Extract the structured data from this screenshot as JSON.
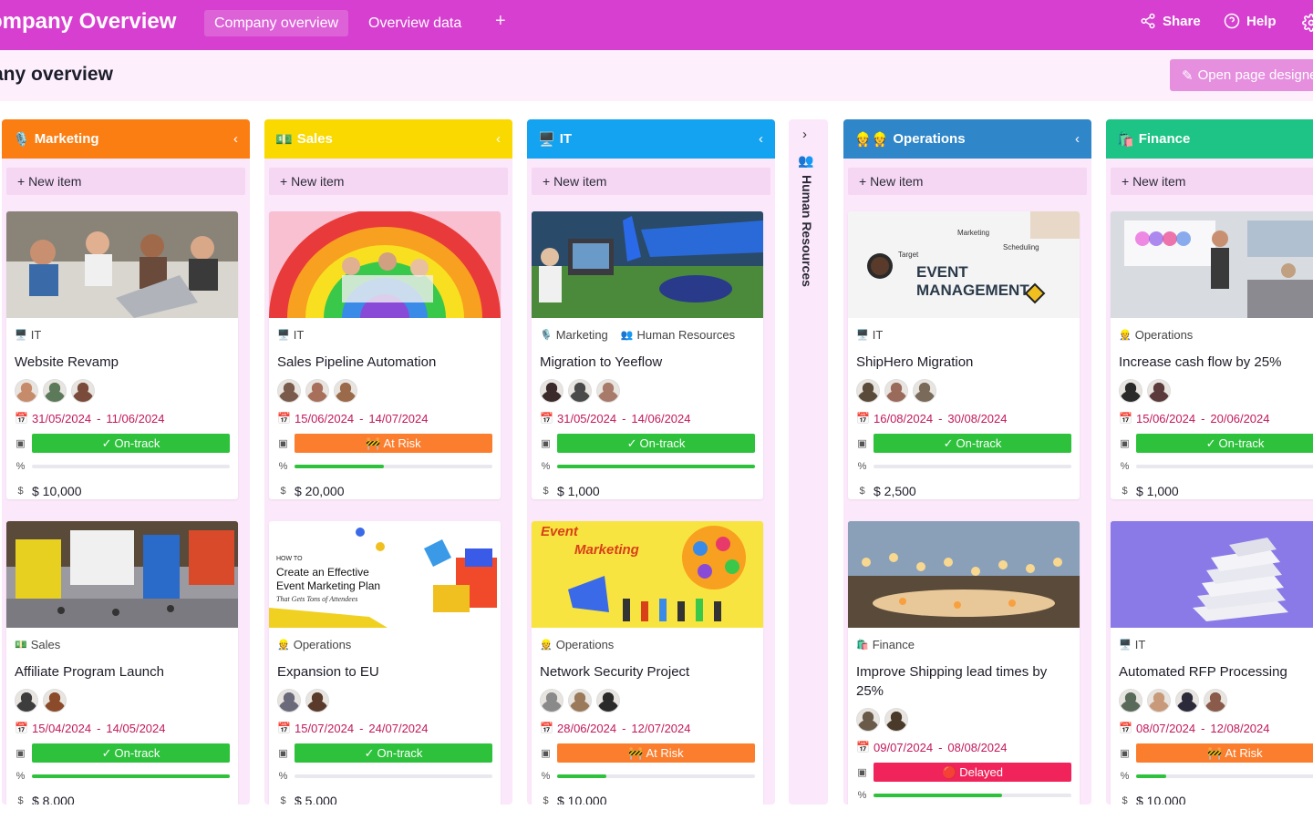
{
  "app": {
    "title": "ompany Overview",
    "tabs": [
      {
        "label": "Company overview",
        "active": true
      },
      {
        "label": "Overview data",
        "active": false
      }
    ],
    "add_tab": "+",
    "share_label": "Share",
    "help_label": "Help",
    "brand_color": "#d63fcf"
  },
  "page": {
    "title": "any overview",
    "designer_button": "Open page designe"
  },
  "columns": [
    {
      "name": "Marketing",
      "icon": "🎙️",
      "color": "#fb7e13",
      "new_item": "+ New item",
      "chev": "‹",
      "cards": [
        {
          "tags": [
            {
              "icon": "🖥️",
              "label": "IT"
            }
          ],
          "title": "Website Revamp",
          "avatars": [
            "#c68b6b",
            "#5c7a5a",
            "#7a4a3a"
          ],
          "start": "31/05/2024",
          "end": "11/06/2024",
          "status": "On-track",
          "status_icon": "✓",
          "status_color": "#2ec23c",
          "progress": 0,
          "budget": "$ 10,000",
          "image": "meeting"
        },
        {
          "tags": [
            {
              "icon": "💵",
              "label": "Sales"
            }
          ],
          "title": "Affiliate Program Launch",
          "avatars": [
            "#3d3d3d",
            "#8b4a2a"
          ],
          "start": "15/04/2024",
          "end": "14/05/2024",
          "status": "On-track",
          "status_icon": "✓",
          "status_color": "#2ec23c",
          "progress": 100,
          "budget": "$ 8,000",
          "image": "expo"
        }
      ]
    },
    {
      "name": "Sales",
      "icon": "💵",
      "color": "#f9d900",
      "new_item": "+ New item",
      "chev": "‹",
      "cards": [
        {
          "tags": [
            {
              "icon": "🖥️",
              "label": "IT"
            }
          ],
          "title": "Sales Pipeline Automation",
          "avatars": [
            "#7a5a4a",
            "#a8705a",
            "#9a6a4a"
          ],
          "start": "15/06/2024",
          "end": "14/07/2024",
          "status": "At Risk",
          "status_icon": "🚧",
          "status_color": "#fb7e2e",
          "progress": 45,
          "budget": "$ 20,000",
          "image": "rainbow"
        },
        {
          "tags": [
            {
              "icon": "👷",
              "label": "Operations"
            }
          ],
          "title": "Expansion to EU",
          "avatars": [
            "#6a6a7a",
            "#5a3a2a"
          ],
          "start": "15/07/2024",
          "end": "24/07/2024",
          "status": "On-track",
          "status_icon": "✓",
          "status_color": "#2ec23c",
          "progress": 0,
          "budget": "$ 5,000",
          "image": "marketing-plan"
        }
      ]
    },
    {
      "name": "IT",
      "icon": "🖥️",
      "color": "#14a3f0",
      "new_item": "+ New item",
      "chev": "‹",
      "cards": [
        {
          "tags": [
            {
              "icon": "🎙️",
              "label": "Marketing"
            },
            {
              "icon": "👥",
              "label": "Human Resources"
            }
          ],
          "title": "Migration to Yeeflow",
          "avatars": [
            "#3a2a2a",
            "#4a4a4a",
            "#a87a6a"
          ],
          "start": "31/05/2024",
          "end": "14/06/2024",
          "status": "On-track",
          "status_icon": "✓",
          "status_color": "#2ec23c",
          "progress": 100,
          "budget": "$ 1,000",
          "image": "tent"
        },
        {
          "tags": [
            {
              "icon": "👷",
              "label": "Operations"
            }
          ],
          "title": "Network Security Project",
          "avatars": [
            "#8a8a8a",
            "#9a7a5a",
            "#2a2a2a"
          ],
          "start": "28/06/2024",
          "end": "12/07/2024",
          "status": "At Risk",
          "status_icon": "🚧",
          "status_color": "#fb7e2e",
          "progress": 25,
          "budget": "$ 10,000",
          "image": "event-marketing"
        }
      ]
    },
    {
      "name": "Human Resources",
      "icon": "👥",
      "collapsed": true,
      "chev": "›"
    },
    {
      "name": "Operations",
      "icon": "👷👷",
      "color": "#2f86c9",
      "new_item": "+ New item",
      "chev": "‹",
      "cards": [
        {
          "tags": [
            {
              "icon": "🖥️",
              "label": "IT"
            }
          ],
          "title": "ShipHero Migration",
          "avatars": [
            "#5a4a3a",
            "#9a6a5a",
            "#7a6a5a"
          ],
          "start": "16/08/2024",
          "end": "30/08/2024",
          "status": "On-track",
          "status_icon": "✓",
          "status_color": "#2ec23c",
          "progress": 0,
          "budget": "$ 2,500",
          "image": "event-management"
        },
        {
          "tags": [
            {
              "icon": "🛍️",
              "label": "Finance"
            }
          ],
          "title": "Improve Shipping lead times by 25%",
          "avatars": [
            "#6a5a4a",
            "#4a3a2a"
          ],
          "start": "09/07/2024",
          "end": "08/08/2024",
          "status": "Delayed",
          "status_icon": "🔴",
          "status_color": "#f0245a",
          "progress": 65,
          "budget": "",
          "image": "lights"
        }
      ]
    },
    {
      "name": "Finance",
      "icon": "🛍️",
      "color": "#1dc486",
      "new_item": "+ New item",
      "chev": "‹",
      "cards": [
        {
          "tags": [
            {
              "icon": "👷",
              "label": "Operations"
            }
          ],
          "title": "Increase cash flow by 25%",
          "avatars": [
            "#2a2a2a",
            "#5a3a3a"
          ],
          "start": "15/06/2024",
          "end": "20/06/2024",
          "status": "On-track",
          "status_icon": "✓",
          "status_color": "#2ec23c",
          "progress": 0,
          "budget": "$ 1,000",
          "image": "presentation"
        },
        {
          "tags": [
            {
              "icon": "🖥️",
              "label": "IT"
            }
          ],
          "title": "Automated RFP Processing",
          "avatars": [
            "#5a6a5a",
            "#c89a7a",
            "#2a2a3a",
            "#8a5a4a"
          ],
          "start": "08/07/2024",
          "end": "12/08/2024",
          "status": "At Risk",
          "status_icon": "🚧",
          "status_color": "#fb7e2e",
          "progress": 15,
          "budget": "$ 10,000",
          "image": "papers"
        }
      ]
    }
  ]
}
